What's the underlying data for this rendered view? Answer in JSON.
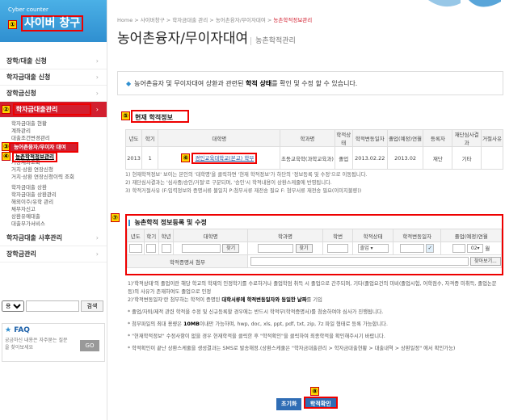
{
  "sidebar": {
    "brand_sub": "Cyber counter",
    "brand_title": "사이버 창구",
    "markers": {
      "m1": "①",
      "m2": "②",
      "m3": "③",
      "m4": "④"
    },
    "nav": [
      {
        "label": "장학/대출 신청"
      },
      {
        "label": "학자금대출 신청"
      },
      {
        "label": "장학금신청"
      },
      {
        "label": "학자금대출관리"
      }
    ],
    "sub1": [
      "학자금대출 현황",
      "계좌관리",
      "대출조건변경관리",
      "농어촌융자/무이자 대여"
    ],
    "sub2": [
      "농촌학적정보관리",
      "거상계좌조회",
      "거치·상환 연장신청",
      "거치·상환 연장신청이력 조회"
    ],
    "sub3": [
      "학자금대출 상환",
      "학자금대출 상환관리",
      "해외이주/유학 관리",
      "채무자신고",
      "상환유예대출",
      "대출부가서비스"
    ],
    "nav2": [
      {
        "label": "학자금대출 사후관리"
      },
      {
        "label": "장학금관리"
      }
    ],
    "search": {
      "select": "용어",
      "button": "검색"
    },
    "faq": {
      "title": "FAQ",
      "desc": "궁금하신 내용은 자주묻는 질문을 찾아보세요",
      "go": "GO"
    }
  },
  "header": {
    "breadcrumb": [
      "Home",
      "사이버창구",
      "학자금대출 관리",
      "농어촌융자/무이자대여"
    ],
    "breadcrumb_current": "농촌학적정보관리",
    "title": "농어촌융자/무이자대여",
    "subtitle": "농촌학적관리"
  },
  "guide": {
    "pre": "농어촌융자 및 무이자대여 상환과 관련된",
    "bold": "학적 상태",
    "post": "를 확인 및 수정 할 수 있습니다."
  },
  "current": {
    "marker": "⑤",
    "title": "현재 학적정보",
    "headers": [
      "년도",
      "학기",
      "대학명",
      "학과명",
      "학적상태",
      "학적변동일자",
      "졸업(예정)연월",
      "등록자",
      "재단심사결과",
      "거절사유"
    ],
    "row": {
      "year": "2013",
      "sem": "1",
      "marker": "⑥",
      "univ": "경인교육대학교(본교) 학부",
      "dept": "초등교육학(과학교육과)",
      "status": "졸업",
      "change": "2013.02.22",
      "grad": "2013.02",
      "reg": "재단",
      "result": "기타",
      "reason": ""
    },
    "notes": [
      "1) 현재학적정보' 보이는 본인의 '대학명'을 클릭하면 '현재 학적정보'가 하단의 '정보등록 및 수정'으로 이동됩니다.",
      "2) 재단심사결과는 '심사중/승인/거절'로 구분되며, '승인'시 학적내용이 상환스케줄에 반영됩니다.",
      "3) 학적거절사유 (F:입력정보와 증명서류 불일치 P:첨부서류 재전송 필요 F: 첨부서류 재전송 필요(이미지불량))"
    ]
  },
  "reg": {
    "marker": "⑦",
    "title": "농촌학적 정보등록 및 수정",
    "headers": [
      "년도",
      "학기",
      "학년",
      "대학명",
      "학과명",
      "학번",
      "학적상태",
      "학적변동일자",
      "졸업(예정)연월"
    ],
    "search_btn": "찾기",
    "status_value": "졸업",
    "month_value": "02",
    "month_suffix": "월",
    "attach_label": "학적증명서 첨부",
    "attach_btn": "찾아보기..."
  },
  "notes2": [
    {
      "pre": "1)'학적상태'의 졸업이란 해당 학교의 학제의 인정학기를 수료하거나 졸업학점 취득 시 졸업으로 간주되며, 기타(졸업요건의 미비(졸업시험, 어학점수, 자격증 미취득, 졸업논문 등)의 사유가 존재하여도 졸업으로 인정",
      "bold": "",
      "post": ""
    },
    {
      "pre": "2)'학적변동일자'란 첨부하는 학적이 증명된 ",
      "bold": "대학서류에 학적변동일자와 동일한 날짜",
      "post": "를 기입"
    },
    {
      "pre": "* 졸업/자퇴/제적 관련 학적을 수정 및 신규등록할 경우에는 반드시 학적부(학적증명서)를 첨송하여야 심사가 진행됩니다.",
      "bold": "",
      "post": ""
    },
    {
      "pre": "* 첨부파일의 최대 용량은 ",
      "bold": "10MB",
      "post": "이내만 가능하며, hwp, doc, xls, ppt, pdf, txt, zip, 7z 파일 형태로 등록 가능합니다."
    },
    {
      "pre": "* \"현재학적정보\" 수정사항이 없을 경우 현재학적을 클릭한 후 \"학적확인\"을 클릭하여 최종학적을 확인해주시기 바랍니다.",
      "bold": "",
      "post": ""
    },
    {
      "pre": "* 학적확인이 끝난 상환스케줄을 생성결과는 SMS로 발송해정.(상환스케줄은 \"학자금대출관리 > 학자금대출현황 > 대출내역 > 상환일정\" 에서 확인가능)",
      "bold": "",
      "post": ""
    }
  ],
  "buttons": {
    "marker": "⑧",
    "reset": "초기화",
    "confirm": "학적확인"
  },
  "colors": {
    "accent": "#d21f2f",
    "brand": "#2f8fd0",
    "highlight": "#ffd400",
    "marker_border": "#e00000"
  }
}
